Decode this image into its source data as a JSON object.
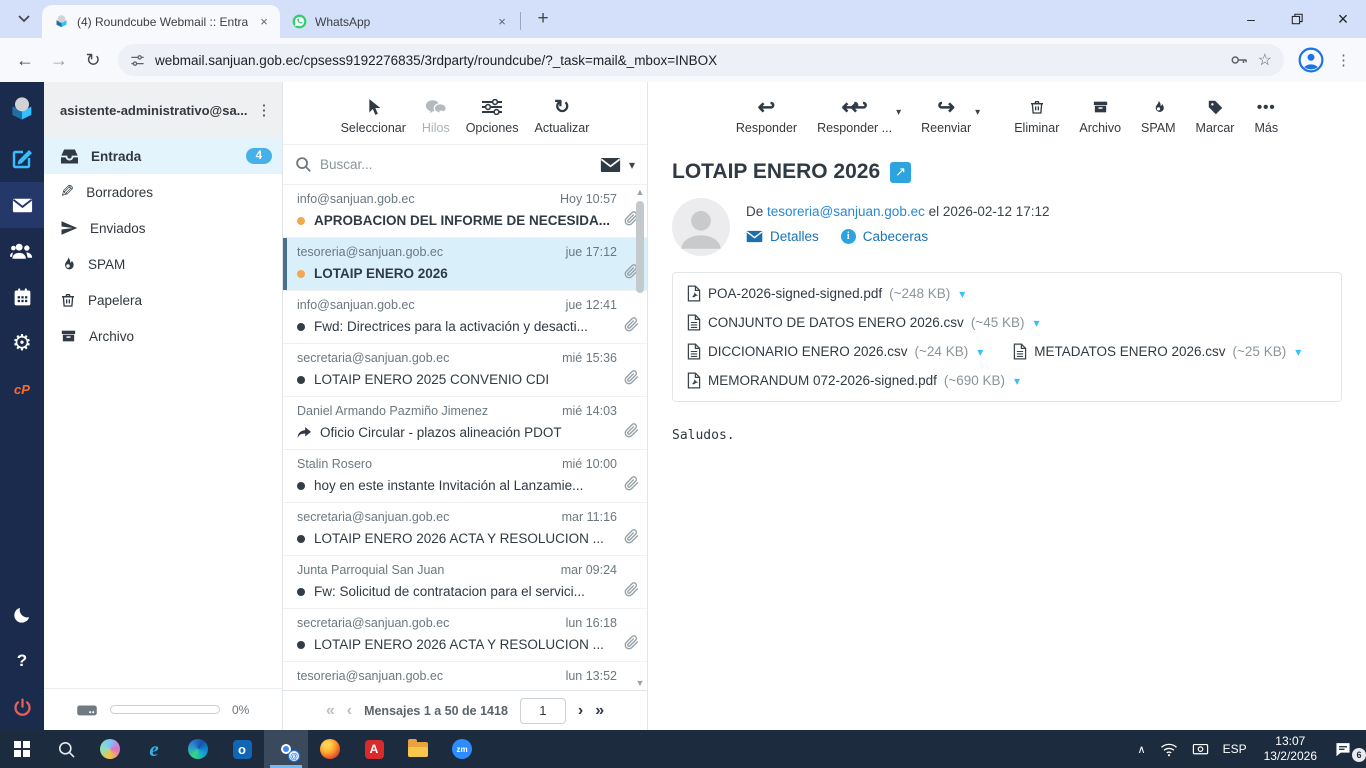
{
  "colors": {
    "accent": "#37beff",
    "rail_bg": "#1b2b4d",
    "selected_row": "#d9f0fb",
    "badge": "#45b1e8",
    "link": "#2787d8",
    "unread_dot": "#f0a94f",
    "taskbar": "#1d2b3f"
  },
  "icons": {
    "back": "←",
    "forward": "→",
    "reload": "↻",
    "star": "☆",
    "menu": "⋮",
    "new_tab": "+",
    "minimize": "–",
    "close": "×",
    "tab_close": "×",
    "chevron_down": "▾",
    "chevron_up": "▲",
    "chevron_down_small": "▼",
    "gear": "⚙",
    "pencil": "✎",
    "help": "?",
    "kebab": "⋮",
    "reply": "↩",
    "forward_mail": "↪",
    "more_dots": "•••",
    "prev_all": "«",
    "prev": "‹",
    "next": "›",
    "next_all": "»",
    "external": "↗",
    "caret": "▾",
    "cpanel": "cP",
    "tray_chevron": "∧",
    "zoom_label": "zm",
    "ie_label": "e",
    "outlook_label": "o",
    "acrobat_label": "A",
    "chrome_badge": "@"
  },
  "browser": {
    "tab1_title": "(4) Roundcube Webmail :: Entra",
    "tab2_title": "WhatsApp",
    "url": "webmail.sanjuan.gob.ec/cpsess9192276835/3rdparty/roundcube/?_task=mail&_mbox=INBOX"
  },
  "folders": {
    "account": "asistente-administrativo@sa...",
    "items": [
      {
        "label": "Entrada",
        "badge": "4"
      },
      {
        "label": "Borradores"
      },
      {
        "label": "Enviados"
      },
      {
        "label": "SPAM"
      },
      {
        "label": "Papelera"
      },
      {
        "label": "Archivo"
      }
    ],
    "quota_percent": "0%"
  },
  "list": {
    "toolbar": {
      "select": "Seleccionar",
      "threads": "Hilos",
      "options": "Opciones",
      "refresh": "Actualizar"
    },
    "search_placeholder": "Buscar...",
    "messages": [
      {
        "sender": "info@sanjuan.gob.ec",
        "date": "Hoy 10:57",
        "subject": "APROBACION DEL INFORME DE NECESIDA..."
      },
      {
        "sender": "tesoreria@sanjuan.gob.ec",
        "date": "jue 17:12",
        "subject": "LOTAIP ENERO 2026"
      },
      {
        "sender": "info@sanjuan.gob.ec",
        "date": "jue 12:41",
        "subject": "Fwd: Directrices para la activación y desacti..."
      },
      {
        "sender": "secretaria@sanjuan.gob.ec",
        "date": "mié 15:36",
        "subject": "LOTAIP ENERO 2025 CONVENIO CDI"
      },
      {
        "sender": "Daniel Armando Pazmiño Jimenez",
        "date": "mié 14:03",
        "subject": "Oficio Circular - plazos alineación PDOT"
      },
      {
        "sender": "Stalin Rosero",
        "date": "mié 10:00",
        "subject": "hoy en este instante Invitación al Lanzamie..."
      },
      {
        "sender": "secretaria@sanjuan.gob.ec",
        "date": "mar 11:16",
        "subject": "LOTAIP ENERO 2026 ACTA Y RESOLUCION ..."
      },
      {
        "sender": "Junta Parroquial San Juan",
        "date": "mar 09:24",
        "subject": "Fw: Solicitud de contratacion para el servici..."
      },
      {
        "sender": "secretaria@sanjuan.gob.ec",
        "date": "lun 16:18",
        "subject": "LOTAIP ENERO 2026 ACTA Y RESOLUCION ..."
      },
      {
        "sender": "tesoreria@sanjuan.gob.ec",
        "date": "lun 13:52",
        "subject": ""
      }
    ],
    "pagination": {
      "label": "Mensajes 1 a 50 de 1418",
      "page": "1"
    }
  },
  "content": {
    "toolbar": {
      "reply": "Responder",
      "reply_all": "Responder ...",
      "forward": "Reenviar",
      "delete": "Eliminar",
      "archive": "Archivo",
      "spam": "SPAM",
      "mark": "Marcar",
      "more": "Más"
    },
    "message": {
      "title": "LOTAIP ENERO 2026",
      "from_prefix": "De",
      "from": "tesoreria@sanjuan.gob.ec",
      "date_connector": "el",
      "date": "2026-02-12 17:12",
      "details_label": "Detalles",
      "headers_label": "Cabeceras",
      "attachments": [
        {
          "name": "POA-2026-signed-signed.pdf",
          "size": "(~248 KB)"
        },
        {
          "name": "CONJUNTO DE DATOS ENERO 2026.csv",
          "size": "(~45 KB)"
        },
        {
          "name": "DICCIONARIO ENERO 2026.csv",
          "size": "(~24 KB)"
        },
        {
          "name": "METADATOS ENERO 2026.csv",
          "size": "(~25 KB)"
        },
        {
          "name": "MEMORANDUM 072-2026-signed.pdf",
          "size": "(~690 KB)"
        }
      ],
      "body": "Saludos."
    }
  },
  "taskbar": {
    "language": "ESP",
    "time": "13:07",
    "date": "13/2/2026",
    "notification_count": "6"
  }
}
